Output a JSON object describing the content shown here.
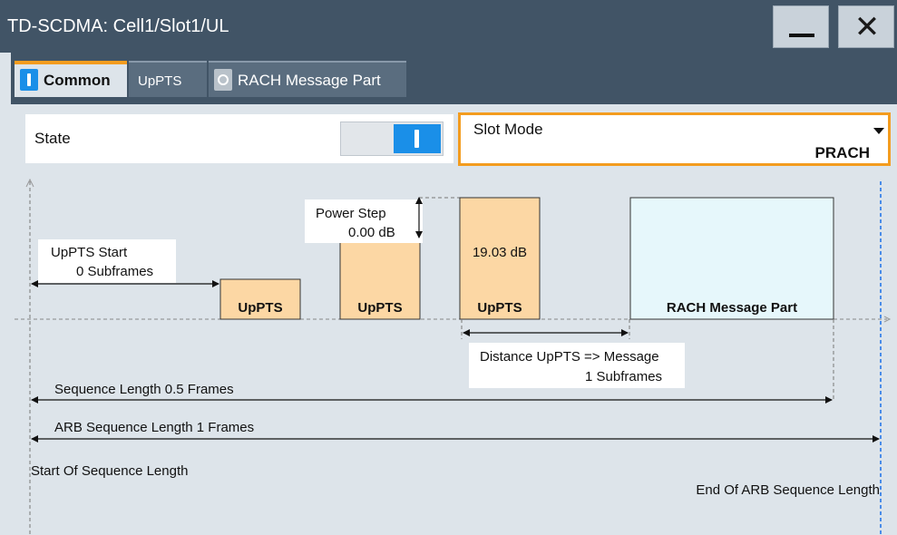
{
  "window": {
    "title": "TD-SCDMA: Cell1/Slot1/UL"
  },
  "titlebar": {
    "minimize_icon": "minimize-icon",
    "close_icon": "close-icon",
    "close_glyph": "✕"
  },
  "tabs": [
    {
      "label": "Common",
      "indicator": "on",
      "active": true
    },
    {
      "label": "UpPTS",
      "indicator": "none",
      "active": false
    },
    {
      "label": "RACH Message Part",
      "indicator": "off",
      "active": false
    }
  ],
  "state": {
    "label": "State",
    "value": "on"
  },
  "slot_mode": {
    "label": "Slot Mode",
    "value": "PRACH"
  },
  "diagram": {
    "uppts_start_label": "UpPTS Start",
    "uppts_start_value": "0  Subframes",
    "power_step_label": "Power Step",
    "power_step_value": "0.00 dB",
    "power_level": "19.03 dB",
    "block_uppts_1": "UpPTS",
    "block_uppts_2": "UpPTS",
    "block_uppts_3": "UpPTS",
    "block_rach": "RACH Message Part",
    "distance_label": "Distance UpPTS => Message",
    "distance_value": "1  Subframes",
    "sequence_length": "Sequence Length 0.5 Frames",
    "arb_sequence_length": "ARB Sequence Length 1 Frames",
    "start_of_sequence": "Start Of Sequence Length",
    "end_of_arb_sequence": "End Of ARB Sequence Length"
  },
  "colors": {
    "accent": "#f39c1f",
    "toggle_on": "#1a8fe8",
    "uppts_block": "#fcd7a4",
    "rach_block": "#e6f7fb",
    "titlebar": "#415466"
  }
}
